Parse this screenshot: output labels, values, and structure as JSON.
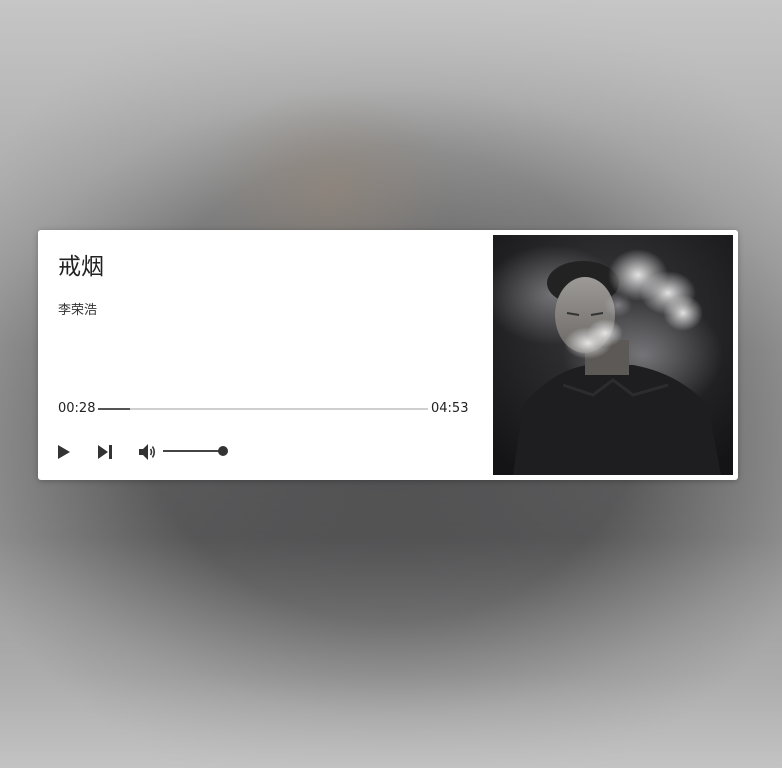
{
  "track": {
    "title": "戒烟",
    "artist": "李荣浩"
  },
  "playback": {
    "current_time": "00:28",
    "duration": "04:53",
    "progress_fraction": 0.096
  },
  "controls": {
    "play_icon": "play-icon",
    "next_icon": "skip-next-icon",
    "volume_icon": "volume-icon",
    "volume_level": 1.0
  },
  "colors": {
    "card_background": "#ffffff",
    "control_color": "#333333",
    "track_color": "#cfcfcf"
  }
}
